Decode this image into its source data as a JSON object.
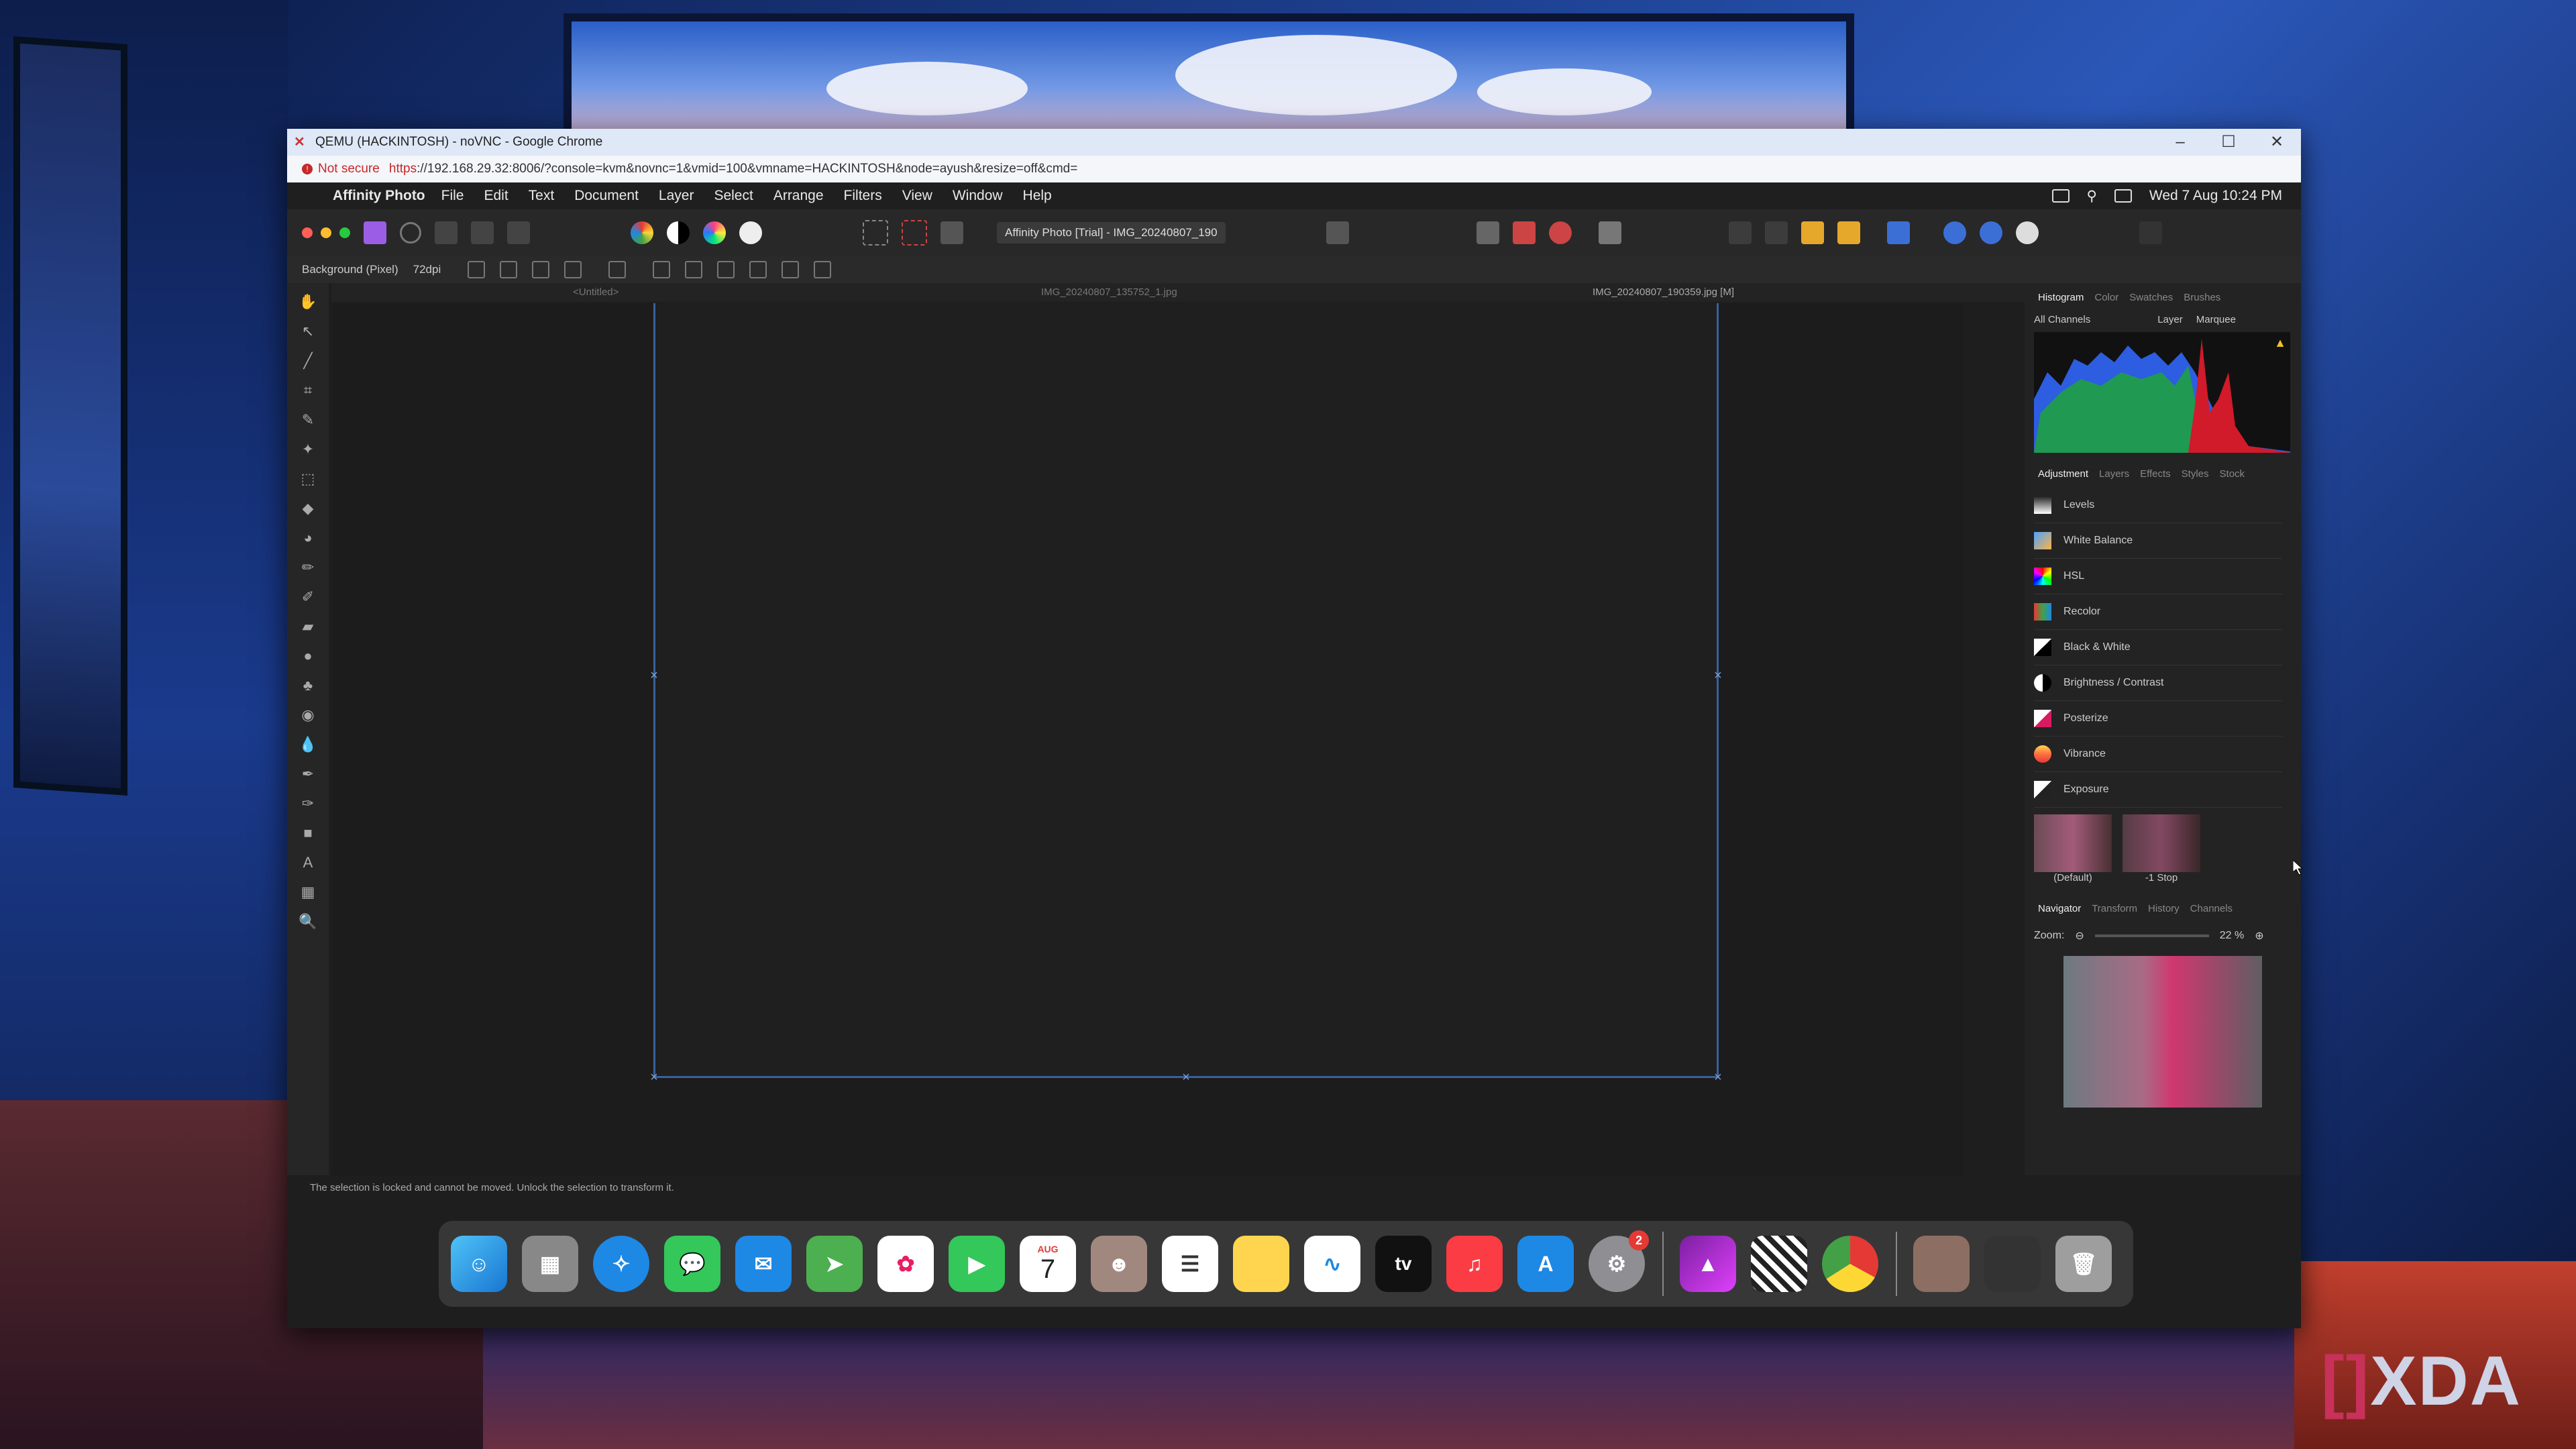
{
  "chrome": {
    "title": "QEMU (HACKINTOSH) - noVNC - Google Chrome",
    "not_secure": "Not secure",
    "url_proto": "https",
    "url_rest": "://192.168.29.32:8006/?console=kvm&novnc=1&vmid=100&vmname=HACKINTOSH&node=ayush&resize=off&cmd="
  },
  "menubar": {
    "app": "Affinity Photo",
    "items": [
      "File",
      "Edit",
      "Text",
      "Document",
      "Layer",
      "Select",
      "Arrange",
      "Filters",
      "View",
      "Window",
      "Help"
    ],
    "datetime": "Wed 7 Aug  10:24 PM"
  },
  "toolbar": {
    "doc_title": "Affinity Photo [Trial] - IMG_20240807_190"
  },
  "context": {
    "layer": "Background (Pixel)",
    "dpi": "72dpi"
  },
  "doc_tabs": {
    "tab1": "<Untitled>",
    "tab2": "IMG_20240807_135752_1.jpg",
    "tab3": "IMG_20240807_190359.jpg [M]"
  },
  "histogram_panel": {
    "tabs": [
      "Histogram",
      "Color",
      "Swatches",
      "Brushes"
    ],
    "channel": "All Channels",
    "opt_layer": "Layer",
    "opt_marquee": "Marquee"
  },
  "adjustment_panel": {
    "tabs": [
      "Adjustment",
      "Layers",
      "Effects",
      "Styles",
      "Stock"
    ],
    "items": [
      "Levels",
      "White Balance",
      "HSL",
      "Recolor",
      "Black & White",
      "Brightness / Contrast",
      "Posterize",
      "Vibrance",
      "Exposure"
    ],
    "preset_default": "(Default)",
    "preset_stop": "-1 Stop"
  },
  "navigator_panel": {
    "tabs": [
      "Navigator",
      "Transform",
      "History",
      "Channels"
    ],
    "zoom_label": "Zoom:",
    "zoom_value": "22 %"
  },
  "status": "The selection is locked and cannot be moved. Unlock the selection to transform it.",
  "dock": {
    "calendar_month": "AUG",
    "calendar_day": "7",
    "settings_badge": "2"
  },
  "watermark": {
    "brand": "XDA"
  }
}
